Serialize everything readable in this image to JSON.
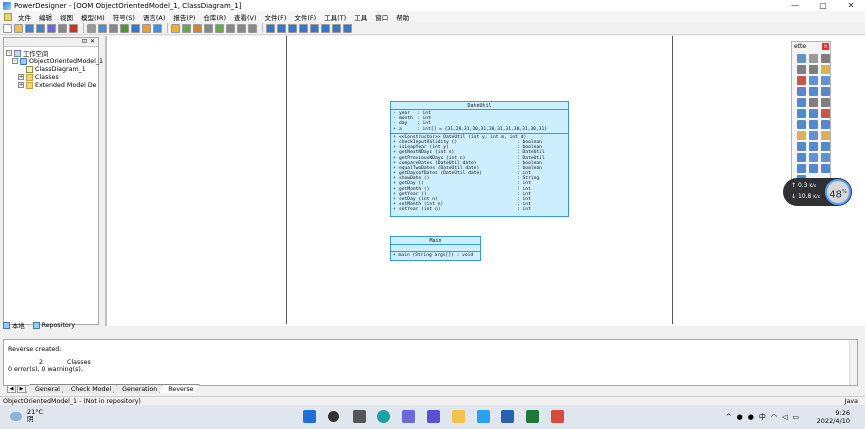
{
  "window": {
    "title": "PowerDesigner - [OOM ObjectOrientedModel_1, ClassDiagram_1]",
    "buttons": [
      "—",
      "▢",
      "✕"
    ]
  },
  "menu": [
    "文件",
    "编辑",
    "视图",
    "模型(M)",
    "符号(S)",
    "语言(A)",
    "报告(P)",
    "仓库(R)",
    "查看(V)",
    "文件(F)",
    "文件(F)",
    "工具(T)",
    "工具",
    "窗口",
    "帮助"
  ],
  "toolbar_colors": [
    "#ffffff",
    "#e8c050",
    "#4a7fc9",
    "#4a7fc9",
    "#6b6bd6",
    "#888888",
    "#c0392b",
    "#999999",
    "#4a90d9",
    "#888888",
    "#5a8f3a",
    "#3a76c4",
    "#e59f2d",
    "#4a90d9",
    "#e2b23d",
    "#6aa84f",
    "#c9893b",
    "#888888",
    "#6aa84f",
    "#888888",
    "#888888",
    "#888888",
    "#3a76c4",
    "#3a76c4",
    "#3a76c4",
    "#3a76c4",
    "#3a76c4",
    "#3a76c4",
    "#3a76c4",
    "#3a76c4"
  ],
  "browser": {
    "root": "工作空间",
    "model": "ObjectOrientedModel_1",
    "diagram": "ClassDiagram_1",
    "folder1": "Classes",
    "folder2": "Extended Model De",
    "tab_local": "本地",
    "tab_repo": "Repository"
  },
  "classes": {
    "dateutil": {
      "name": "DateUtil",
      "attributes": [
        {
          "vis": "-",
          "name": "year",
          "type": ": int"
        },
        {
          "vis": "-",
          "name": "month",
          "type": ": int"
        },
        {
          "vis": "-",
          "name": "day",
          "type": ": int"
        },
        {
          "vis": "+",
          "name": "a",
          "type": ": int[]   = {31,28,31,30,31,30,31,31,30,31,30,31}"
        }
      ],
      "operations": [
        {
          "vis": "+",
          "name": "<<Constructor>> DateUtil (int y, int m, int d)",
          "type": ""
        },
        {
          "vis": "+",
          "name": "checkInputValidity ()",
          "type": ": boolean"
        },
        {
          "vis": "+",
          "name": "isLeapYear (int y)",
          "type": ": boolean"
        },
        {
          "vis": "+",
          "name": "getNextNDays (int n)",
          "type": ": DateUtil"
        },
        {
          "vis": "+",
          "name": "getPreviousNDays (int n)",
          "type": ": DateUtil"
        },
        {
          "vis": "+",
          "name": "compareDates (DateUtil date)",
          "type": ": boolean"
        },
        {
          "vis": "+",
          "name": "equalTwoDates (DateUtil date)",
          "type": ": boolean"
        },
        {
          "vis": "+",
          "name": "getDaysofDates (DateUtil date)",
          "type": ": int"
        },
        {
          "vis": "+",
          "name": "showDate ()",
          "type": ": String"
        },
        {
          "vis": "+",
          "name": "getDay ()",
          "type": ": int"
        },
        {
          "vis": "+",
          "name": "getMonth ()",
          "type": ": int"
        },
        {
          "vis": "+",
          "name": "getYear ()",
          "type": ": int"
        },
        {
          "vis": "+",
          "name": "setDay (int n)",
          "type": ": int"
        },
        {
          "vis": "+",
          "name": "setMonth (int n)",
          "type": ": int"
        },
        {
          "vis": "+",
          "name": "setYear (int n)",
          "type": ": int"
        }
      ]
    },
    "main": {
      "name": "Main",
      "operation": "+  main (String args[]) : void"
    }
  },
  "palette": {
    "title": "ette",
    "close": "x",
    "tool_colors": [
      "#4a7fc9",
      "#888888",
      "#6a6a6a",
      "#6a6a6a",
      "#6a6a6a",
      "#d2a640",
      "#c0392b",
      "#4a7fc9",
      "#4a7fc9",
      "#3a76c4",
      "#3a76c4",
      "#3a76c4",
      "#3a76c4",
      "#6a6a6a",
      "#6a6a6a",
      "#3a76c4",
      "#3a76c4",
      "#c0392b",
      "#3a76c4",
      "#3a76c4",
      "#3a76c4",
      "#d2a640",
      "#4a7fc9",
      "#d2a640",
      "#3a76c4",
      "#3a76c4",
      "#3a76c4",
      "#3a76c4",
      "#4a7fc9",
      "#4a7fc9",
      "#3a76c4",
      "#3a76c4",
      "#3a76c4",
      "#3a76c4"
    ]
  },
  "netspeed": {
    "up": "0.3",
    "up_unit": "K/s",
    "down": "10.8",
    "down_unit": "K/s",
    "percent": "48",
    "percent_sign": "%"
  },
  "output": {
    "line1": "Reverse created:",
    "count": "2",
    "count_label": "Classes",
    "line3": "0 error(s), 0 warning(s).",
    "tabs": [
      "General",
      "Check Model",
      "Generation",
      "Reverse"
    ]
  },
  "status": {
    "left": "ObjectOrientedModel_1 - (Not in repository)",
    "right": "Java"
  },
  "taskbar": {
    "temp": "21°C",
    "weather": "阴",
    "ime": "中",
    "time": "9:26",
    "date": "2022/4/10"
  }
}
